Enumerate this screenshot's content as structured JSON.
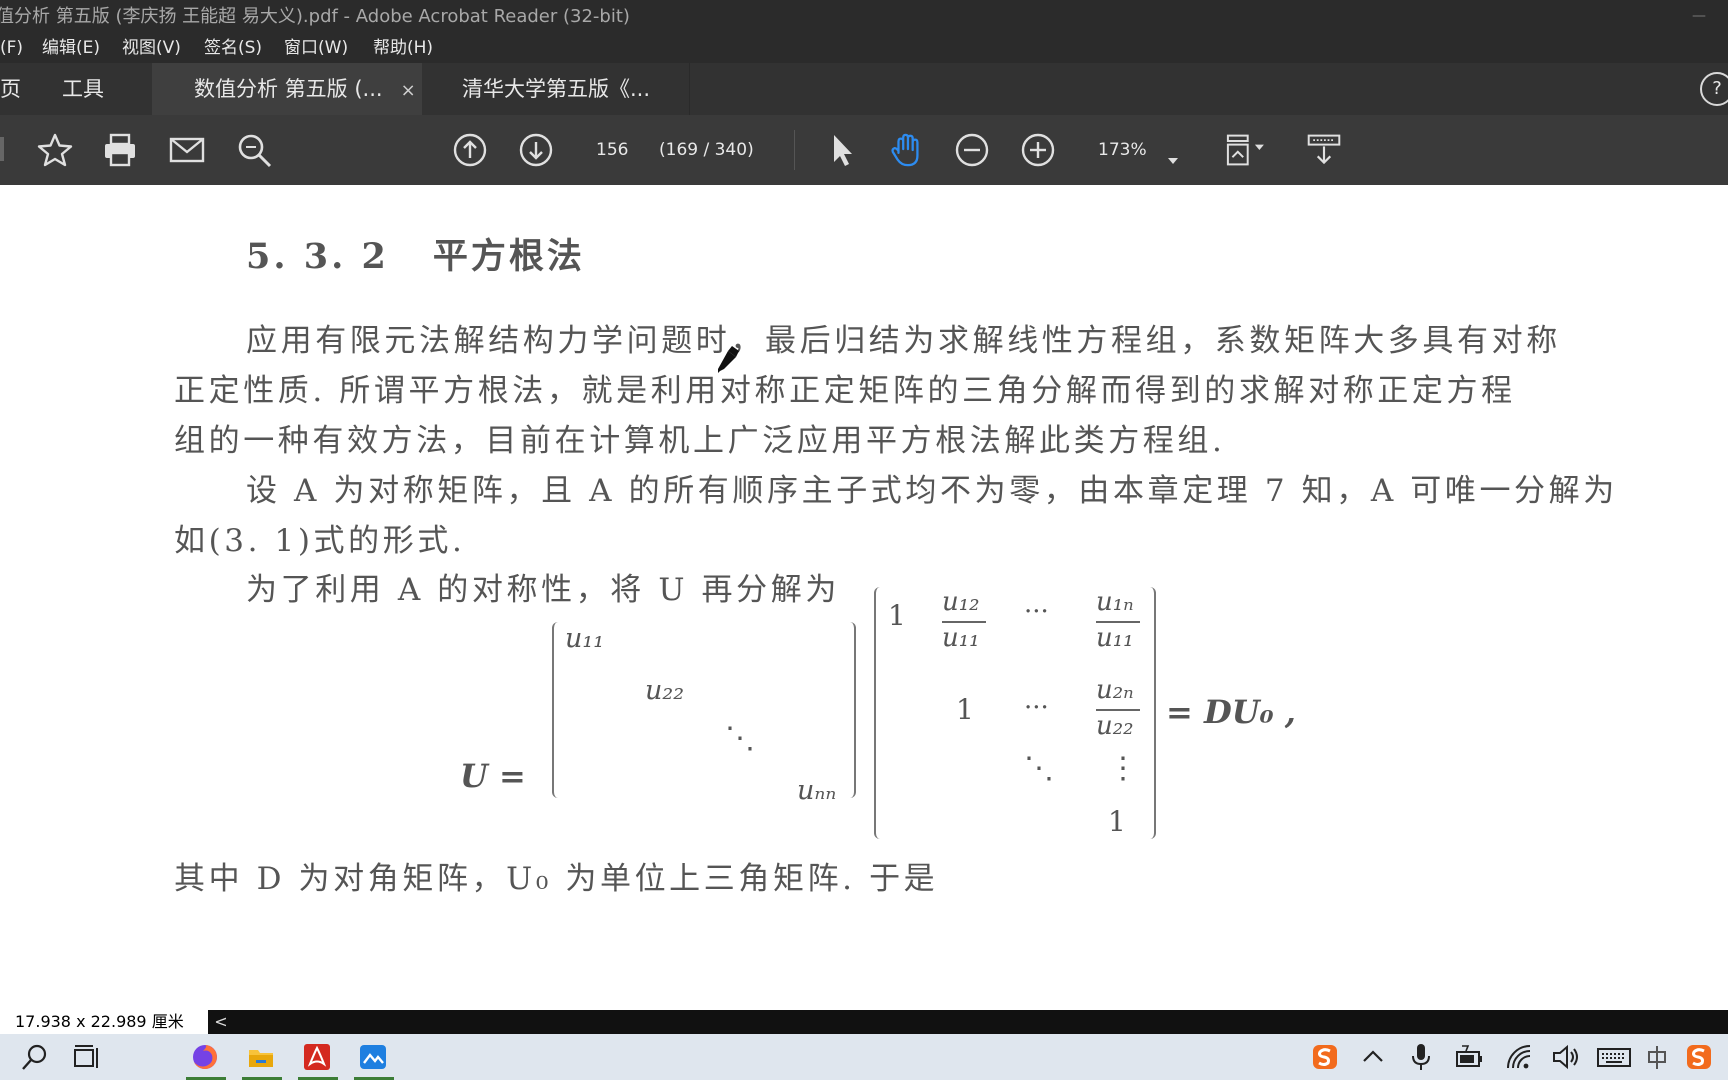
{
  "window": {
    "title": "值分析 第五版 (李庆扬 王能超 易大义).pdf - Adobe Acrobat Reader (32-bit)"
  },
  "menu": [
    "(F)",
    "编辑(E)",
    "视图(V)",
    "签名(S)",
    "窗口(W)",
    "帮助(H)"
  ],
  "tabs": {
    "home": "页",
    "tools": "工具",
    "doc1": "数值分析 第五版 (...",
    "doc1_close": "×",
    "doc2": "清华大学第五版《...",
    "help": "?"
  },
  "toolbar": {
    "page_input": "156",
    "page_count": "(169 / 340)",
    "zoom": "173%"
  },
  "doc": {
    "section_num": "5. 3. 2",
    "section_title": "平方根法",
    "p1_l1": "应用有限元法解结构力学问题时，最后归结为求解线性方程组，系数矩阵大多具有对称",
    "p1_l2": "正定性质. 所谓平方根法，就是利用对称正定矩阵的三角分解而得到的求解对称正定方程",
    "p1_l3": "组的一种有效方法，目前在计算机上广泛应用平方根法解此类方程组.",
    "p2_l1": "设 A 为对称矩阵，且 A 的所有顺序主子式均不为零，由本章定理 7 知，A 可唯一分解为",
    "p2_l2": "如(3. 1)式的形式.",
    "p3_l1": "为了利用 A 的对称性，将 U 再分解为",
    "p4_l1": "其中 D 为对角矩阵，U₀ 为单位上三角矩阵. 于是",
    "eq": {
      "lhs": "U =",
      "u11": "u₁₁",
      "u22": "u₂₂",
      "unn": "uₙₙ",
      "ddots": "⋱",
      "one": "1",
      "u12": "u₁₂",
      "u1n": "u₁ₙ",
      "u2n": "u₂ₙ",
      "cdots": "···",
      "vdots": "⋮",
      "rhs": "= DU₀ ,"
    }
  },
  "status": {
    "dimensions": "17.938 x 22.989 厘米",
    "collapse": "<"
  },
  "colors": {
    "acrobat_red": "#d4291f",
    "hand_tool_blue": "#2d8cf0",
    "sogou_orange": "#f26b1d"
  }
}
